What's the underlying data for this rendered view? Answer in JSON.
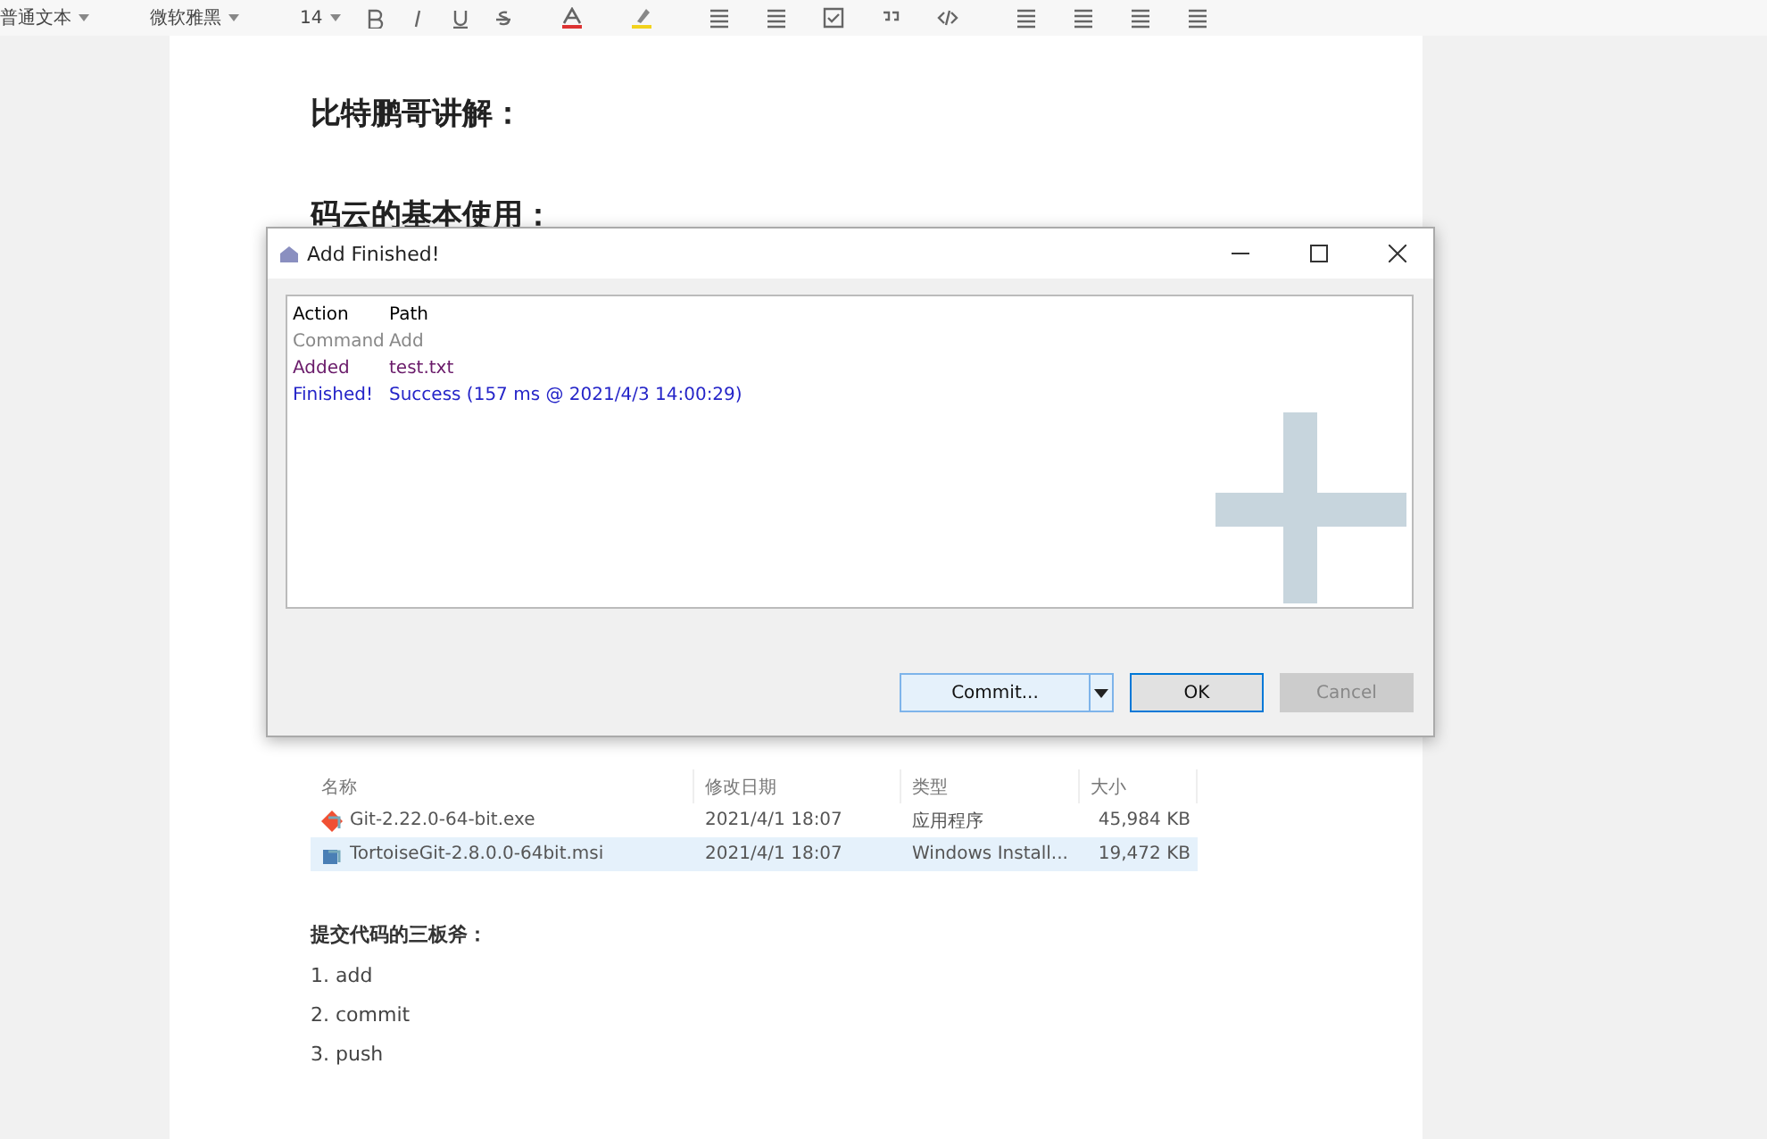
{
  "toolbar": {
    "style": "普通文本",
    "font": "微软雅黑",
    "size": "14"
  },
  "document": {
    "headings": [
      "比特鹏哥讲解：",
      "码云的基本使用："
    ],
    "files": {
      "columns": [
        "名称",
        "修改日期",
        "类型",
        "大小"
      ],
      "rows": [
        {
          "name": "Git-2.22.0-64-bit.exe",
          "date": "2021/4/1 18:07",
          "type": "应用程序",
          "size": "45,984 KB",
          "selected": false
        },
        {
          "name": "TortoiseGit-2.8.0.0-64bit.msi",
          "date": "2021/4/1 18:07",
          "type": "Windows Install...",
          "size": "19,472 KB",
          "selected": true
        }
      ]
    },
    "subheading": "提交代码的三板斧：",
    "steps": [
      "1. add",
      "2. commit",
      "3. push"
    ]
  },
  "dialog": {
    "title": "Add Finished!",
    "log": [
      {
        "kind": "header",
        "action": "Action",
        "path": "Path"
      },
      {
        "kind": "command",
        "action": "Command",
        "path": "Add"
      },
      {
        "kind": "added",
        "action": "Added",
        "path": "test.txt"
      },
      {
        "kind": "finished",
        "action": "Finished!",
        "path": "Success (157 ms @ 2021/4/3 14:00:29)"
      }
    ],
    "buttons": [
      {
        "label": "Commit...",
        "kind": "split",
        "disabled": false
      },
      {
        "label": "OK",
        "kind": "default",
        "disabled": false
      },
      {
        "label": "Cancel",
        "kind": "plain",
        "disabled": true
      }
    ]
  }
}
